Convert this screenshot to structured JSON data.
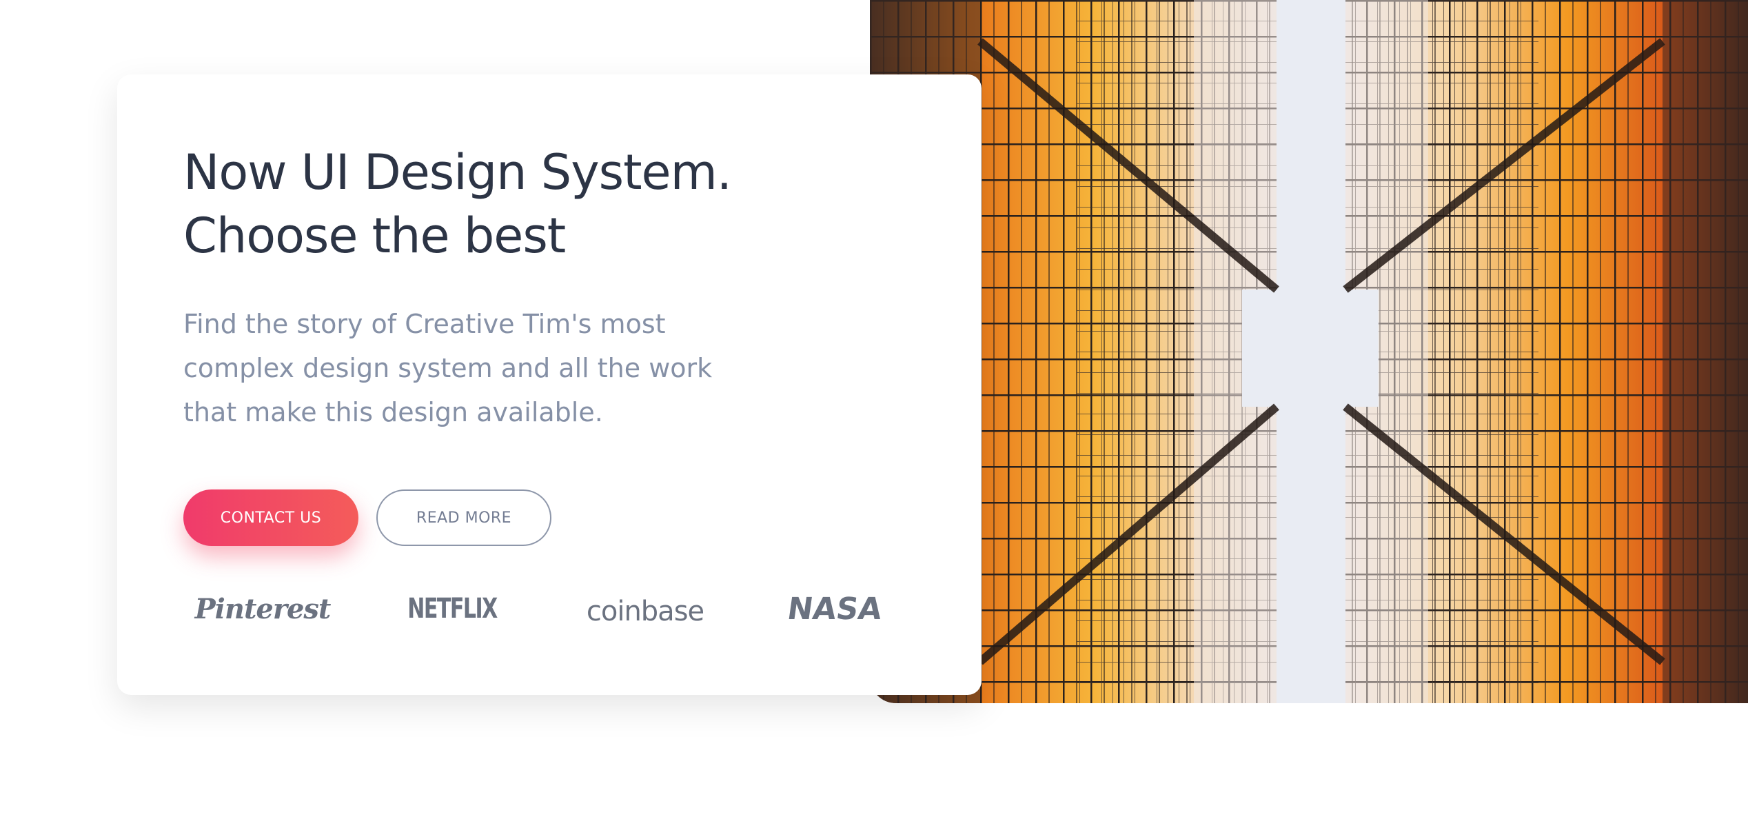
{
  "hero": {
    "title_lines": [
      "Now UI Design System.",
      "Choose the best"
    ],
    "description_lines": [
      "Find the story of Creative Tim's most",
      "complex design system and all the work",
      "that make this design available."
    ],
    "buttons": {
      "contact_label": "CONTACT US",
      "read_more_label": "READ MORE"
    },
    "logos": [
      "Pinterest",
      "NETFLIX",
      "coinbase",
      "NASA"
    ]
  },
  "colors": {
    "title": "#2c3445",
    "description": "#8590a6",
    "contact_gradient_start": "#f03b6b",
    "contact_gradient_end": "#f45c5a",
    "logo_gray": "#6b7280",
    "glass_orange": "#f08a1c",
    "glass_yellow": "#f6b43a",
    "sky": "#e9ecf3"
  },
  "image": {
    "subject": "looking-up-between-glass-skyscrapers"
  }
}
